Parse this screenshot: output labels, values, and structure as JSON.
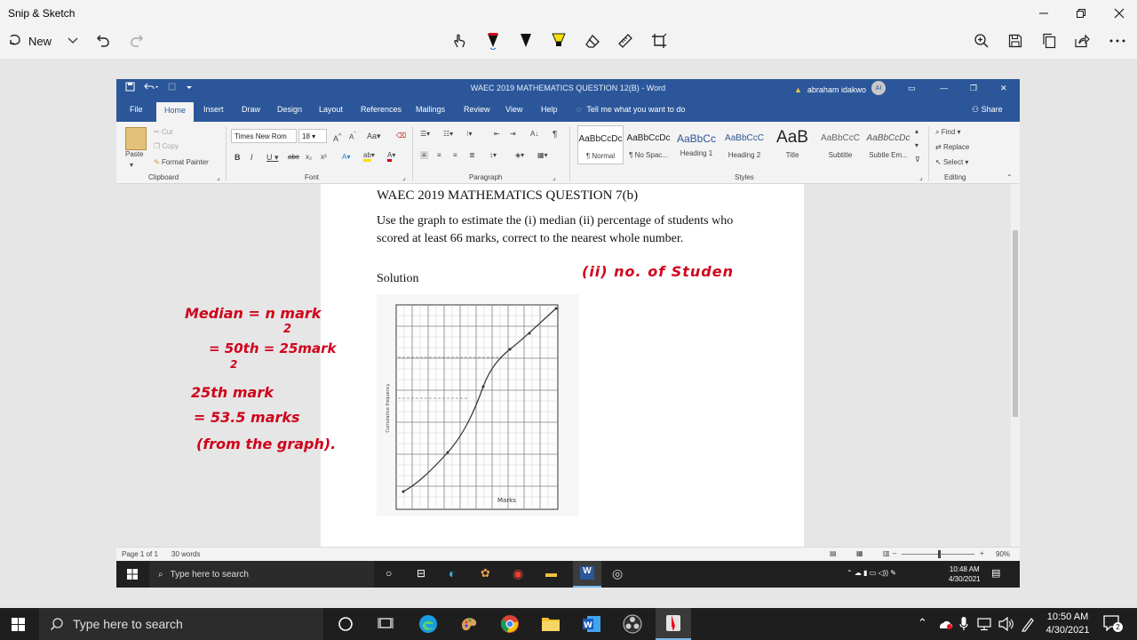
{
  "window": {
    "title": "Snip & Sketch"
  },
  "toolbar": {
    "new_label": "New"
  },
  "word": {
    "title": "WAEC 2019 MATHEMATICS QUESTION 12(B) - Word",
    "user": "abraham idakwo",
    "avatar": "AI",
    "tabs": [
      "File",
      "Home",
      "Insert",
      "Draw",
      "Design",
      "Layout",
      "References",
      "Mailings",
      "Review",
      "View",
      "Help"
    ],
    "tell_me": "Tell me what you want to do",
    "share": "Share",
    "clipboard": {
      "paste": "Paste",
      "cut": "Cut",
      "copy": "Copy",
      "format_painter": "Format Painter",
      "label": "Clipboard"
    },
    "font": {
      "name": "Times New Rom",
      "size": "18",
      "label": "Font"
    },
    "paragraph": {
      "label": "Paragraph"
    },
    "styles": {
      "label": "Styles",
      "items": [
        {
          "preview": "AaBbCcDc",
          "name": "¶ Normal"
        },
        {
          "preview": "AaBbCcDc",
          "name": "¶ No Spac..."
        },
        {
          "preview": "AaBbCc",
          "name": "Heading 1"
        },
        {
          "preview": "AaBbCcC",
          "name": "Heading 2"
        },
        {
          "preview": "AaB",
          "name": "Title"
        },
        {
          "preview": "AaBbCcC",
          "name": "Subtitle"
        },
        {
          "preview": "AaBbCcDc",
          "name": "Subtle Em..."
        }
      ]
    },
    "editing": {
      "find": "Find",
      "replace": "Replace",
      "select": "Select",
      "label": "Editing"
    },
    "document": {
      "heading": "WAEC 2019 MATHEMATICS QUESTION 7(b)",
      "question": "Use the graph to estimate the (i) median (ii) percentage of students who scored at least 66 marks, correct to the nearest whole number.",
      "solution": "Solution",
      "graph_xlabel": "Marks",
      "graph_ylabel": "Cumulative frequency"
    },
    "ink": {
      "line1": "Median = n mark",
      "line1_den": "2",
      "line2": "= 50th = 25mark",
      "line2_den": "2",
      "line3": "25th mark",
      "line4": "= 53.5 marks",
      "line5": "(from the graph).",
      "right": "(ii)   no. of Studen"
    },
    "status": {
      "page": "Page 1 of 1",
      "words": "30 words",
      "zoom": "90%"
    },
    "inner_taskbar": {
      "search": "Type here to search",
      "time": "10:48 AM",
      "date": "4/30/2021"
    }
  },
  "taskbar": {
    "search": "Type here to search",
    "time": "10:50 AM",
    "date": "4/30/2021",
    "notifications": "2"
  }
}
